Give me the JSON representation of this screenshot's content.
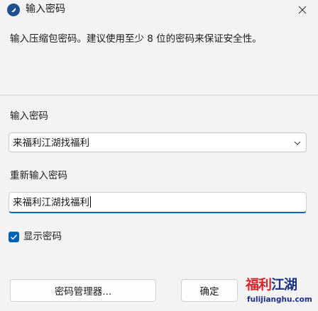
{
  "window": {
    "title": "输入密码",
    "description": "输入压缩包密码。建议使用至少 8 位的密码来保证安全性。"
  },
  "fields": {
    "password_label": "输入密码",
    "password_value": "来福利江湖找福利",
    "confirm_label": "重新输入密码",
    "confirm_value": "来福利江湖找福利"
  },
  "options": {
    "show_password_label": "显示密码",
    "show_password_checked": true
  },
  "buttons": {
    "manager_label": "密码管理器...",
    "ok_label": "确定"
  },
  "watermark": {
    "chars": [
      "福",
      "利",
      "江",
      "湖"
    ],
    "site": "fulijianghu.com"
  },
  "colors": {
    "accent": "#005fb8",
    "input_focus": "#0a64c8",
    "watermark_red": "#d8232a",
    "watermark_blue": "#1c2f86"
  },
  "icons": {
    "app": "bandizip-icon",
    "close": "close-icon",
    "dropdown": "chevron-down-icon",
    "check": "checkmark-icon"
  }
}
